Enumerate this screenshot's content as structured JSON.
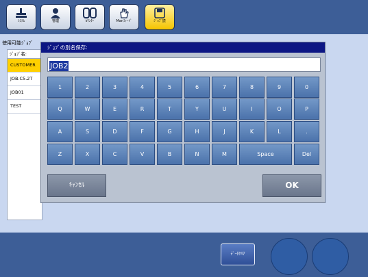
{
  "toolbar": {
    "buttons": [
      {
        "label": "ｼｽﾃﾑ",
        "icon": "system-icon"
      },
      {
        "label": "管理",
        "icon": "user-icon"
      },
      {
        "label": "ｶｳﾝﾀｰ",
        "icon": "counter-icon"
      },
      {
        "label": "Manﾌｨｰﾄﾞ",
        "icon": "hand-icon"
      },
      {
        "label": "ｼﾞｮﾌﾞ読",
        "icon": "floppy-icon",
        "active": true
      }
    ]
  },
  "screen": {
    "title": "使用可能ｼﾞｮﾌﾞ",
    "job_list": {
      "header": "ｼﾞｮﾌﾞ名:",
      "items": [
        "CUSTOMER",
        "JOB.C5.2T",
        "JOB01",
        "TEST"
      ],
      "selected": "CUSTOMER"
    }
  },
  "dialog": {
    "title": "ｼﾞｮﾌﾞの別名保存:",
    "name_value": "JOB2",
    "keyboard": {
      "rows": [
        [
          "1",
          "2",
          "3",
          "4",
          "5",
          "6",
          "7",
          "8",
          "9",
          "0"
        ],
        [
          "Q",
          "W",
          "E",
          "R",
          "T",
          "Y",
          "U",
          "I",
          "O",
          "P"
        ],
        [
          "A",
          "S",
          "D",
          "F",
          "G",
          "H",
          "J",
          "K",
          "L",
          "."
        ],
        [
          "Z",
          "X",
          "C",
          "V",
          "B",
          "N",
          "M",
          "Space",
          "Del"
        ]
      ]
    },
    "cancel_label": "ｷｬﾝｾﾙ",
    "ok_label": "OK"
  },
  "bottom": {
    "clear_label": "ﾃﾞｰﾀｸﾘｱ"
  },
  "colors": {
    "bar": "#3d5e97",
    "dialog_title": "#0c1684",
    "key": "#5a82b9",
    "selected": "#ffd000",
    "active_tab": "#f5c400"
  }
}
